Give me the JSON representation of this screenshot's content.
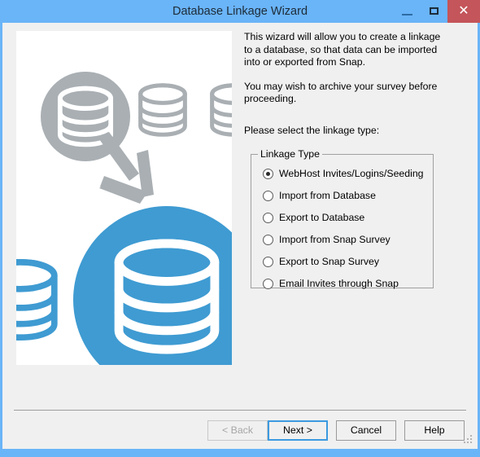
{
  "window": {
    "title": "Database Linkage Wizard",
    "controls": {
      "minimize": {
        "name": "minimize-button",
        "glyph": "—"
      },
      "maximize": {
        "name": "maximize-button",
        "glyph": "▢"
      },
      "close": {
        "name": "close-button",
        "glyph": "✕"
      }
    },
    "colors": {
      "titlebar": "#6ab4f8",
      "close_button": "#c4555a",
      "body": "#f0f0f0",
      "accent_blue": "#3c9ae0",
      "illustration_blue": "#3f9bd2",
      "illustration_grey": "#a9afb3"
    }
  },
  "illustration": {
    "name": "database-linkage-illustration",
    "description": "Grey database cylinders with an arrow pointing to blue database cylinders"
  },
  "intro": {
    "paragraph1": "This wizard will allow you to create a linkage to a database, so that data can be imported into or exported from Snap.",
    "paragraph2": "You may wish to archive your survey before proceeding.",
    "prompt": "Please select the linkage type:"
  },
  "linkage_type": {
    "legend": "Linkage Type",
    "selected": "WebHost Invites/Logins/Seeding",
    "options": [
      {
        "label": "WebHost Invites/Logins/Seeding",
        "checked": true
      },
      {
        "label": "Import from Database",
        "checked": false
      },
      {
        "label": "Export to Database",
        "checked": false
      },
      {
        "label": "Import from Snap Survey",
        "checked": false
      },
      {
        "label": "Export to Snap Survey",
        "checked": false
      },
      {
        "label": "Email Invites through Snap",
        "checked": false
      }
    ]
  },
  "buttons": {
    "back": "< Back",
    "next": "Next >",
    "cancel": "Cancel",
    "help": "Help"
  }
}
